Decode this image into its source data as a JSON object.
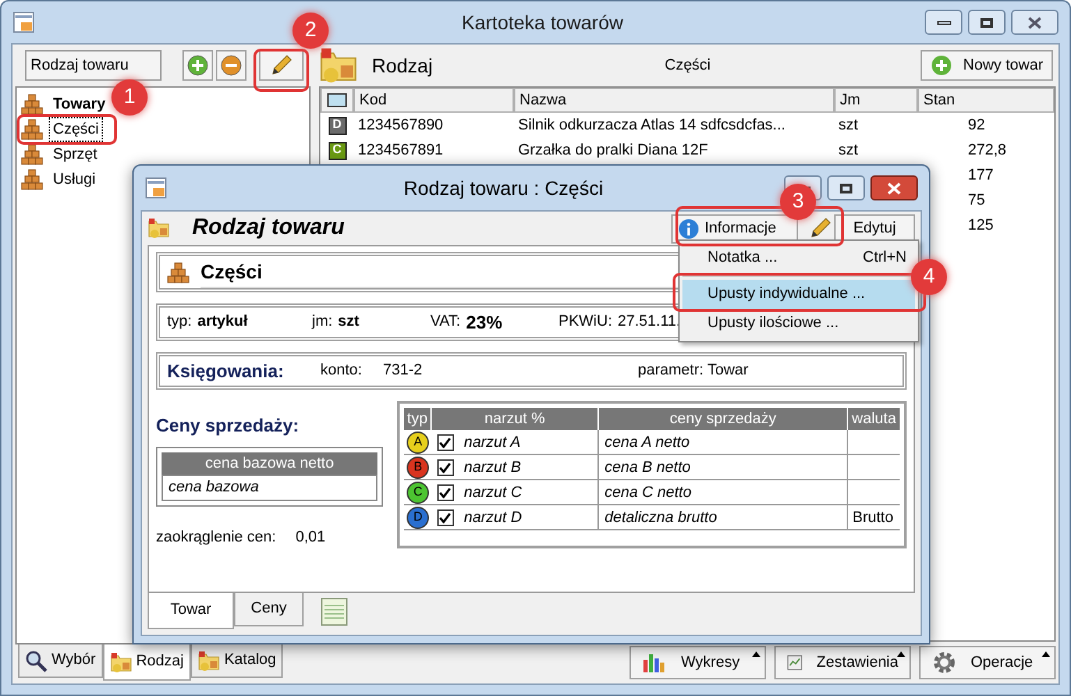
{
  "window": {
    "title": "Kartoteka towarów"
  },
  "left_panel": {
    "field": "Rodzaj towaru",
    "tree": [
      {
        "label": "Towary",
        "kind": "root",
        "selected": false
      },
      {
        "label": "Części",
        "kind": "item",
        "selected": true
      },
      {
        "label": "Sprzęt",
        "kind": "item",
        "selected": false
      },
      {
        "label": "Usługi",
        "kind": "item",
        "selected": false
      }
    ],
    "tabs": [
      {
        "label": "Wybór",
        "selected": false
      },
      {
        "label": "Rodzaj",
        "selected": true
      },
      {
        "label": "Katalog",
        "selected": false
      }
    ]
  },
  "right_panel": {
    "title": "Rodzaj",
    "subtitle": "Części",
    "new_button": "Nowy towar",
    "table": {
      "columns": [
        "Kod",
        "Nazwa",
        "Jm",
        "Stan"
      ],
      "rows": [
        {
          "badge": "D",
          "color": "#6b6b6b",
          "kod": "1234567890",
          "nazwa": "Silnik odkurzacza Atlas 14 sdfcsdcfas...",
          "jm": "szt",
          "stan": "92"
        },
        {
          "badge": "C",
          "color": "#6a9a12",
          "kod": "1234567891",
          "nazwa": "Grzałka do pralki Diana 12F",
          "jm": "szt",
          "stan": "272,8"
        },
        {
          "stan": "177"
        },
        {
          "stan": "75"
        },
        {
          "stan": "125"
        }
      ]
    },
    "toolbar": [
      "Wykresy",
      "Zestawienia",
      "Operacje"
    ]
  },
  "dialog": {
    "title": "Rodzaj towaru : Części",
    "heading": "Rodzaj towaru",
    "info_button": "Informacje",
    "edit_button": "Edytuj",
    "name": "Części",
    "fields": [
      {
        "label": "typ:",
        "value": "artykuł"
      },
      {
        "label": "jm:",
        "value": "szt"
      },
      {
        "label": "VAT:",
        "value": "23%"
      },
      {
        "label": "PKWiU:",
        "value": "27.51.11."
      }
    ],
    "accounting": {
      "title": "Księgowania:",
      "konto_label": "konto:",
      "konto": "731-2",
      "param_label": "parametr:",
      "param": "Towar"
    },
    "prices": {
      "title": "Ceny sprzedaży:",
      "base_header": "cena bazowa netto",
      "base_value": "cena bazowa",
      "rounding_label": "zaokrąglenie cen:",
      "rounding": "0,01",
      "columns": [
        "typ",
        "narzut %",
        "ceny sprzedaży",
        "waluta"
      ],
      "rows": [
        {
          "typ": "A",
          "color": "#e6cf1c",
          "checked": true,
          "narzut": "narzut A",
          "cena": "cena A netto"
        },
        {
          "typ": "B",
          "color": "#d9341f",
          "checked": true,
          "narzut": "narzut B",
          "cena": "cena B netto"
        },
        {
          "typ": "C",
          "color": "#4cc431",
          "checked": true,
          "narzut": "narzut C",
          "cena": "cena C netto"
        },
        {
          "typ": "D",
          "color": "#2a6fd0",
          "checked": true,
          "narzut": "narzut D",
          "cena": "detaliczna brutto",
          "waluta": "Brutto"
        }
      ]
    },
    "tabs": [
      {
        "label": "Towar",
        "selected": true
      },
      {
        "label": "Ceny",
        "selected": false
      }
    ]
  },
  "menu": {
    "items": [
      {
        "label": "Notatka ...",
        "shortcut": "Ctrl+N",
        "selected": false
      },
      {
        "label": "Upusty indywidualne ...",
        "selected": true
      },
      {
        "label": "Upusty ilościowe ...",
        "selected": false
      }
    ]
  },
  "annotations": [
    {
      "number": "1"
    },
    {
      "number": "2"
    },
    {
      "number": "3"
    },
    {
      "number": "4"
    }
  ]
}
